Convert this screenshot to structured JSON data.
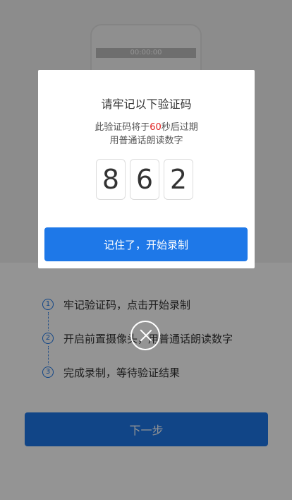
{
  "background": {
    "phone_timer": "00:00:00",
    "steps": [
      {
        "num": "1",
        "text": "牢记验证码，点击开始录制"
      },
      {
        "num": "2",
        "text": "开启前置摄像头，用普通话朗读数字"
      },
      {
        "num": "3",
        "text": "完成录制，等待验证结果"
      }
    ],
    "next_label": "下一步"
  },
  "modal": {
    "title": "请牢记以下验证码",
    "line1_prefix": "此验证码将于",
    "line1_seconds": "60",
    "line1_suffix": "秒后过期",
    "line2": "用普通话朗读数字",
    "code": [
      "8",
      "6",
      "2"
    ],
    "confirm_label": "记住了，开始录制"
  },
  "colors": {
    "accent": "#1e78e8",
    "countdown": "#e02020",
    "overlay": "rgba(0,0,0,0.42)"
  },
  "icons": {
    "close": "close-icon"
  }
}
